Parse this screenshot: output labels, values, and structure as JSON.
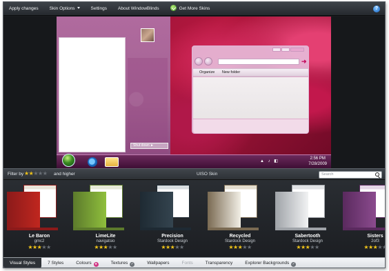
{
  "menubar": {
    "apply_changes": "Apply changes",
    "skin_options": "Skin Options",
    "settings": "Settings",
    "about": "About WindowBlinds",
    "get_more_skins": "Get More Skins",
    "help_label": "?"
  },
  "preview": {
    "shutdown_label": "Shut down ►",
    "explorer": {
      "toolbar_organize": "Organize",
      "toolbar_new_folder": "New folder",
      "go_glyph": "➜"
    },
    "taskbar": {
      "tray_glyphs": "▲ ♪ ◧",
      "clock_time": "2:56 PM",
      "clock_date": "7/28/2009"
    }
  },
  "filter": {
    "label": "Filter by",
    "rating": 2,
    "suffix": "and higher",
    "skin_title": "UISO Skin",
    "search_placeholder": "Search"
  },
  "skins": [
    {
      "name": "Le Baron",
      "author": "gmc2",
      "rating": 3,
      "palette": [
        "#8b1a1a",
        "#c0271f",
        "#e9e4d8"
      ]
    },
    {
      "name": "LimeLite",
      "author": "navigatsio",
      "rating": 3,
      "palette": [
        "#5c7a2c",
        "#8fbf3c",
        "#e7ead8"
      ]
    },
    {
      "name": "Precision",
      "author": "Stardock Design",
      "rating": 3,
      "palette": [
        "#1e2a33",
        "#34444f",
        "#d8dde0"
      ]
    },
    {
      "name": "Recycled",
      "author": "Stardock Design",
      "rating": 3,
      "palette": [
        "#7a6a52",
        "#f2efe6",
        "#e3ddcf"
      ]
    },
    {
      "name": "Sabertooth",
      "author": "Stardock Design",
      "rating": 3,
      "palette": [
        "#9fa3a8",
        "#f1f2f3",
        "#e0e2e5"
      ]
    },
    {
      "name": "Sisters",
      "author": "2of3",
      "rating": 3,
      "palette": [
        "#5a2a5e",
        "#8b4b8e",
        "#e4d6e6"
      ]
    }
  ],
  "tabs": [
    {
      "label": "Visual Styles",
      "state": "active",
      "mark": ""
    },
    {
      "label": "7 Styles",
      "state": "normal",
      "mark": ""
    },
    {
      "label": "Colours",
      "state": "normal",
      "mark": "col"
    },
    {
      "label": "Textures",
      "state": "normal",
      "mark": "ok"
    },
    {
      "label": "Wallpapers",
      "state": "normal",
      "mark": ""
    },
    {
      "label": "Fonts",
      "state": "disabled",
      "mark": ""
    },
    {
      "label": "Transparency",
      "state": "normal",
      "mark": ""
    },
    {
      "label": "Explorer Backgrounds",
      "state": "normal",
      "mark": "ok"
    }
  ],
  "colors": {
    "star_on": "#f0c419",
    "star_off": "#6b7077",
    "accent": "#c4115f"
  }
}
